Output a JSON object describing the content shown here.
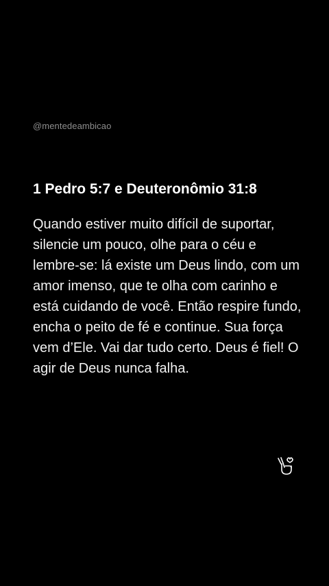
{
  "post": {
    "handle": "@mentedeambicao",
    "title": "1 Pedro 5:7 e Deuteronômio 31:8",
    "body": "Quando estiver muito difícil de suportar, silencie um pouco, olhe para o céu e lembre-se: lá existe um Deus lindo, com um amor imenso, que te olha com carinho e está cuidando de você. Então respire fundo, encha o peito de fé e continue. Sua força vem d’Ele. Vai dar tudo certo. Deus é fiel! O agir de Deus nunca falha."
  },
  "icons": {
    "gesture": "finger-heart-icon"
  },
  "colors": {
    "background": "#000000",
    "text": "#ffffff",
    "handle": "#8e8e8e"
  }
}
